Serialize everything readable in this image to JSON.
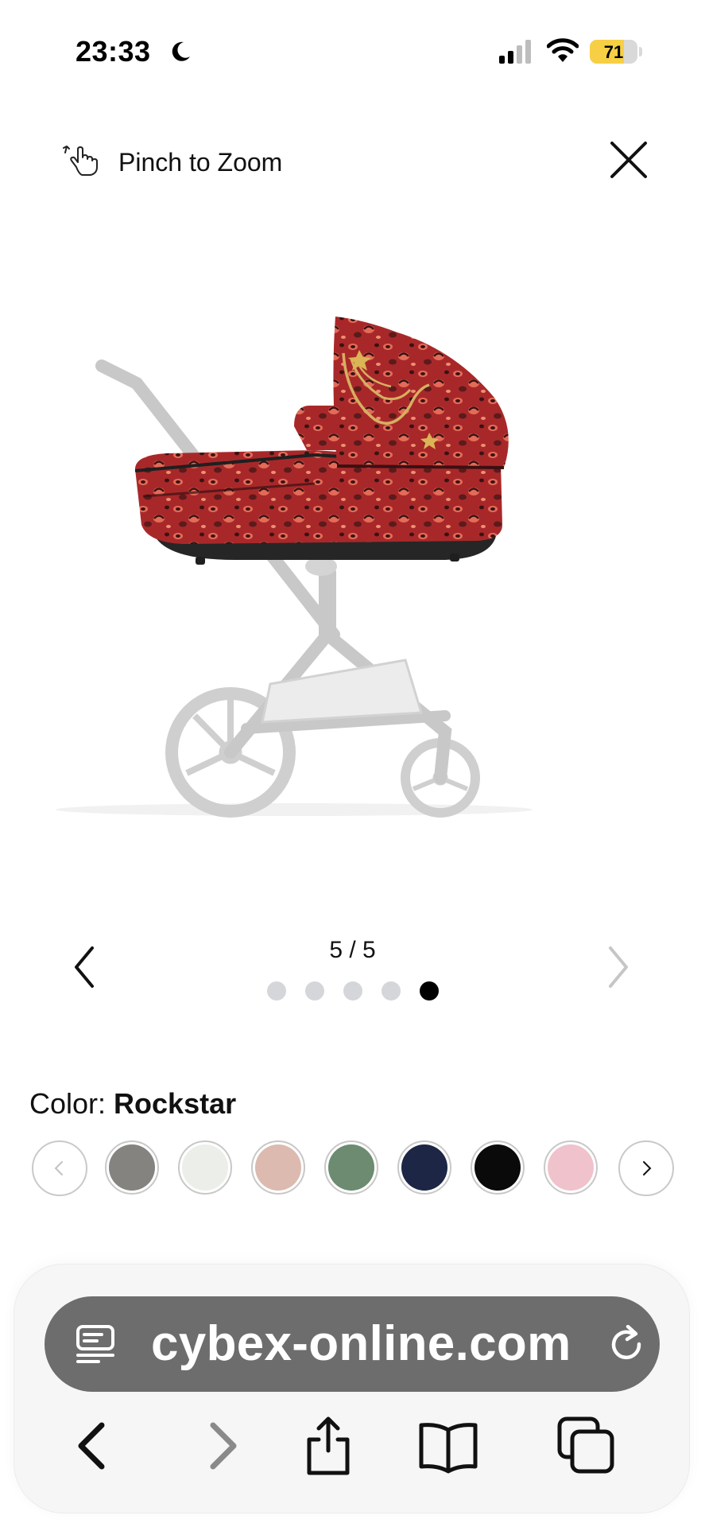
{
  "status_bar": {
    "time": "23:33",
    "battery": "71",
    "battery_level": 0.71
  },
  "zoom_header": {
    "hint": "Pinch to Zoom",
    "pinch_icon": "pinch-hand-icon",
    "close_icon": "close-icon"
  },
  "gallery": {
    "counter": "5 / 5",
    "current": 5,
    "total": 5,
    "prev_icon": "chevron-left-icon",
    "next_icon": "chevron-right-icon"
  },
  "color": {
    "label": "Color:",
    "selected": "Rockstar",
    "swatches": [
      {
        "name": "grey",
        "color": "#858380"
      },
      {
        "name": "off-white",
        "color": "#eceee9"
      },
      {
        "name": "pink-beige",
        "color": "#dcbab0"
      },
      {
        "name": "green",
        "color": "#6c8b70"
      },
      {
        "name": "navy",
        "color": "#1d2644"
      },
      {
        "name": "black-pattern",
        "color": "#0a0a0a"
      },
      {
        "name": "pink-floral",
        "color": "#efc2cc"
      }
    ]
  },
  "browser": {
    "url": "cybex-online.com",
    "reader_icon": "reader-mode-icon",
    "reload_icon": "reload-icon",
    "toolbar": [
      "back-icon",
      "forward-icon",
      "share-icon",
      "bookmarks-icon",
      "tabs-icon"
    ]
  },
  "colors": {
    "accent_selected_dot": "#000000",
    "inactive_dot": "#d4d6da",
    "url_pill": "#6d6d6d",
    "fabric_red": "#a8282a"
  }
}
